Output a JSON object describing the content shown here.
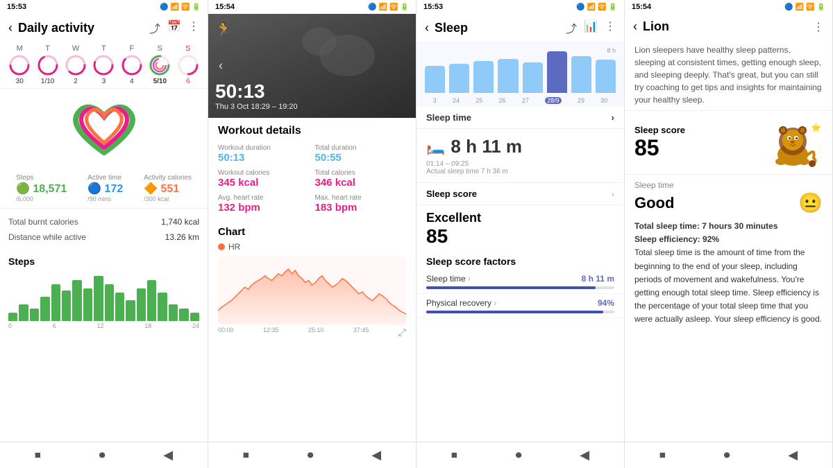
{
  "panel1": {
    "status_time": "15:53",
    "title": "Daily activity",
    "back": "‹",
    "header_icons": [
      "share",
      "calendar",
      "more"
    ],
    "weekdays": [
      {
        "label": "M",
        "date": "30",
        "active": false,
        "sunday": false
      },
      {
        "label": "T",
        "date": "1/10",
        "active": false,
        "sunday": false
      },
      {
        "label": "W",
        "date": "2",
        "active": false,
        "sunday": false
      },
      {
        "label": "T",
        "date": "3",
        "active": false,
        "sunday": false
      },
      {
        "label": "F",
        "date": "4",
        "active": false,
        "sunday": false
      },
      {
        "label": "S",
        "date": "5/10",
        "active": true,
        "sunday": false
      },
      {
        "label": "S",
        "date": "6",
        "active": false,
        "sunday": true
      }
    ],
    "stats": [
      {
        "label": "Steps",
        "icon": "🟢",
        "value": "18,571",
        "sub": "/6,000",
        "color": "green"
      },
      {
        "label": "Active time",
        "icon": "🔵",
        "value": "172",
        "sub": "/90 mins",
        "color": "blue"
      },
      {
        "label": "Activity calories",
        "icon": "🔴",
        "value": "551",
        "sub": "/300 kcal",
        "color": "orange"
      }
    ],
    "info_rows": [
      {
        "key": "Total burnt calories",
        "val": "1,740 kcal"
      },
      {
        "key": "Distance while active",
        "val": "13.26 km"
      }
    ],
    "steps_section_title": "Steps",
    "steps_bars": [
      4,
      8,
      6,
      12,
      18,
      15,
      20,
      16,
      22,
      18,
      14,
      10,
      16,
      20,
      14,
      8,
      6,
      4
    ],
    "chart_x_labels": [
      "0",
      "6",
      "12",
      "18",
      "24"
    ],
    "nav": [
      "⏹",
      "⏺",
      "◀"
    ]
  },
  "panel2": {
    "status_time": "15:54",
    "workout_time": "50:13",
    "workout_datetime": "Thu 3 Oct 18:29 – 19:20",
    "details_title": "Workout details",
    "details": [
      {
        "label": "Workout duration",
        "value": "50:13",
        "color": "blue"
      },
      {
        "label": "Total duration",
        "value": "50:55",
        "color": "blue"
      },
      {
        "label": "Workout calories",
        "value": "345 kcal",
        "color": "pink"
      },
      {
        "label": "Total calories",
        "value": "346 kcal",
        "color": "pink"
      },
      {
        "label": "Avg. heart rate",
        "value": "132 bpm",
        "color": "pink"
      },
      {
        "label": "Max. heart rate",
        "value": "183 bpm",
        "color": "pink"
      }
    ],
    "chart_title": "Chart",
    "legend_label": "HR",
    "chart_x_labels": [
      "00:00",
      "12:35",
      "25:10",
      "37:45"
    ],
    "nav": [
      "⏹",
      "⏺",
      "◀"
    ]
  },
  "panel3": {
    "status_time": "15:53",
    "title": "Sleep",
    "back": "‹",
    "sleep_bar_labels": [
      "3",
      "24",
      "25",
      "26",
      "27",
      "28/9",
      "29",
      "30"
    ],
    "sleep_bar_heights": [
      55,
      60,
      65,
      70,
      62,
      85,
      75,
      68
    ],
    "active_bar_index": 5,
    "sleep_8h_label": "8 h",
    "sleep_time_btn": "Sleep time",
    "sleep_hours": "8 h 11 m",
    "sleep_range": "01:14 – 09:25",
    "sleep_actual": "Actual sleep time  7 h 36 m",
    "sleep_score_label": "Sleep score",
    "sleep_quality": "Excellent",
    "sleep_score": "85",
    "sleep_factors_title": "Sleep score factors",
    "sleep_factors": [
      {
        "name": "Sleep time",
        "value": "8 h 11 m",
        "fill_pct": 90
      },
      {
        "name": "Physical recovery",
        "value": "94%",
        "fill_pct": 94
      }
    ],
    "nav": [
      "⏹",
      "⏺",
      "◀"
    ]
  },
  "panel4": {
    "status_time": "15:54",
    "back": "‹",
    "title": "Lion",
    "more_icon": "⋮",
    "desc": "Lion sleepers have healthy sleep patterns, sleeping at consistent times, getting enough sleep, and sleeping deeply. That's great, but you can still try coaching to get tips and insights for maintaining your healthy sleep.",
    "score_label": "Sleep score",
    "score": "85",
    "sleep_time_label": "Sleep time",
    "sleep_time_quality": "Good",
    "emoji": "😐",
    "detail1_bold": "Total sleep time: 7 hours 30 minutes",
    "detail1_bold2": "Sleep efficiency: 92%",
    "detail_text": "Total sleep time is the amount of time from the beginning to the end of your sleep, including periods of movement and wakefulness. You're getting enough total sleep time.\nSleep efficiency is the percentage of your total sleep time that you were actually asleep. Your sleep efficiency is good.",
    "nav": [
      "⏹",
      "⏺",
      "◀"
    ]
  }
}
